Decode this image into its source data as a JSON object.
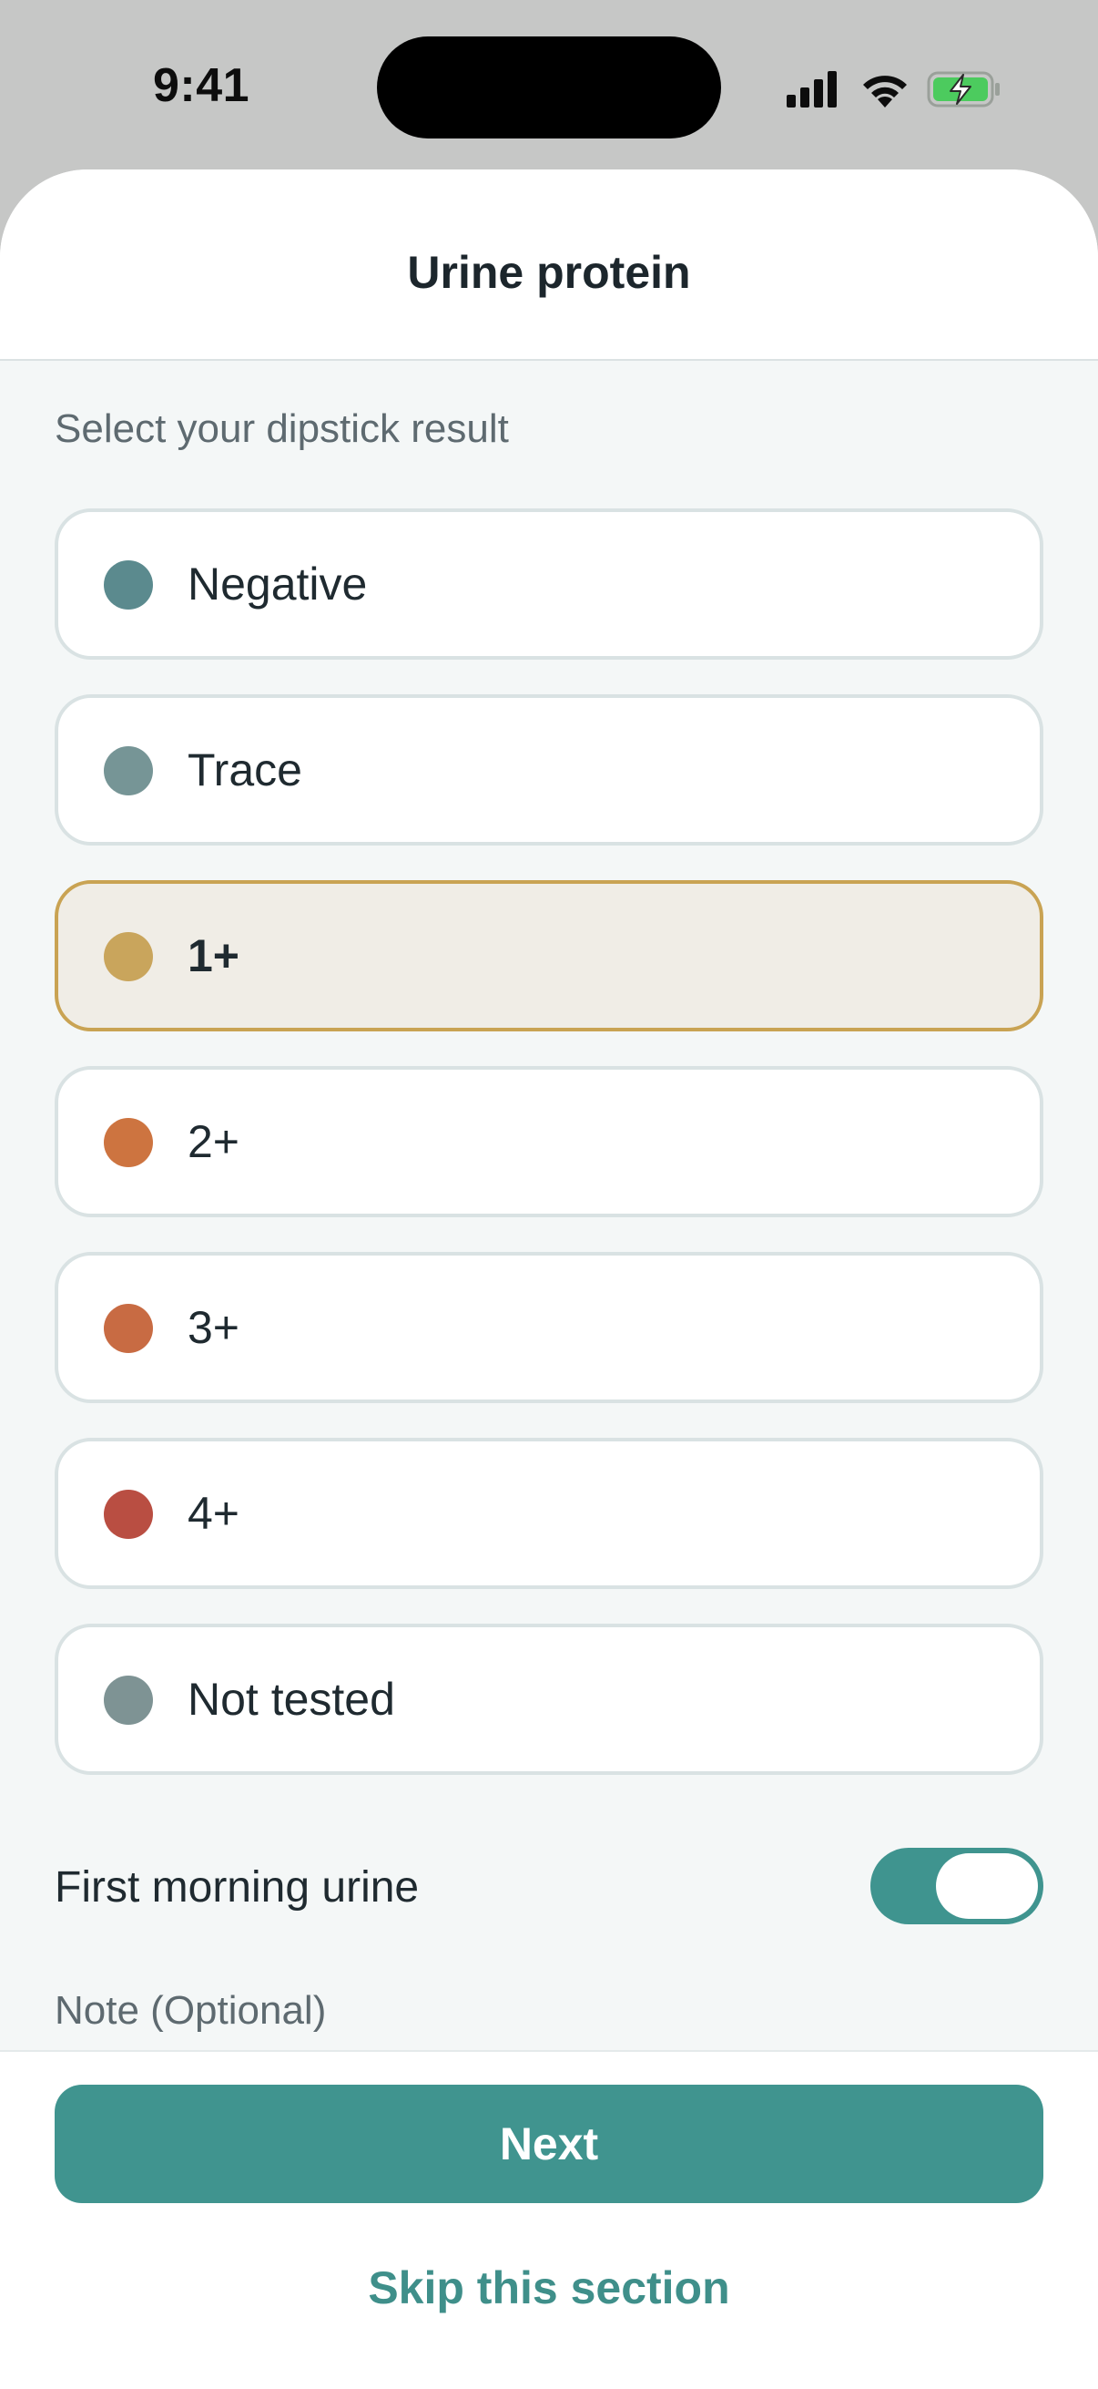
{
  "status_bar": {
    "time": "9:41",
    "icons": [
      "cellular-signal-icon",
      "wifi-icon",
      "battery-charging-icon"
    ]
  },
  "header": {
    "title": "Urine protein"
  },
  "section_label": "Select your dipstick result",
  "options": [
    {
      "label": "Negative",
      "color": "#5b8a8e",
      "selected": false
    },
    {
      "label": "Trace",
      "color": "#769596",
      "selected": false
    },
    {
      "label": "1+",
      "color": "#c9a55c",
      "selected": true
    },
    {
      "label": "2+",
      "color": "#cd7440",
      "selected": false
    },
    {
      "label": "3+",
      "color": "#c86b43",
      "selected": false
    },
    {
      "label": "4+",
      "color": "#b94e42",
      "selected": false
    },
    {
      "label": "Not tested",
      "color": "#7e9394",
      "selected": false
    }
  ],
  "toggle": {
    "label": "First morning urine",
    "on": true
  },
  "note_label": "Note (Optional)",
  "footer": {
    "next_label": "Next",
    "skip_label": "Skip this section"
  },
  "colors": {
    "accent": "#40948f",
    "selected_border": "#c9a353",
    "selected_bg": "#f0ede6"
  }
}
